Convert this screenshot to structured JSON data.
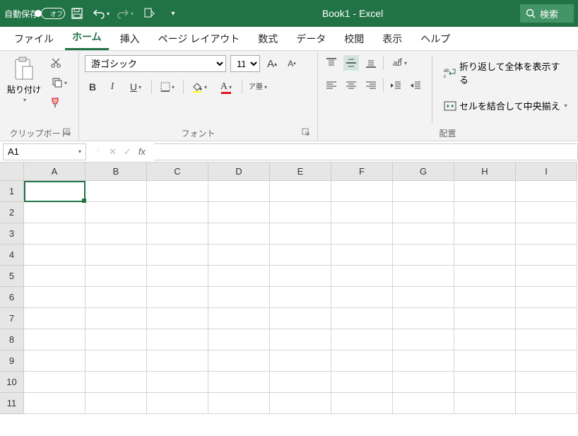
{
  "titlebar": {
    "autosave_label": "自動保存",
    "autosave_state": "オフ",
    "doc_title": "Book1  -  Excel",
    "search_placeholder": "検索"
  },
  "tabs": {
    "items": [
      "ファイル",
      "ホーム",
      "挿入",
      "ページ レイアウト",
      "数式",
      "データ",
      "校閲",
      "表示",
      "ヘルプ"
    ],
    "active_index": 1
  },
  "ribbon": {
    "clipboard": {
      "paste": "貼り付け",
      "label": "クリップボード"
    },
    "font": {
      "name": "游ゴシック",
      "size": "11",
      "label": "フォント",
      "bold": "B",
      "italic": "I",
      "underline": "U",
      "phonetic": "ア亜"
    },
    "align": {
      "label": "配置",
      "wrap": "折り返して全体を表示する",
      "merge": "セルを結合して中央揃え"
    }
  },
  "formula_bar": {
    "cell_ref": "A1",
    "fx": "fx",
    "value": ""
  },
  "sheet": {
    "columns": [
      "A",
      "B",
      "C",
      "D",
      "E",
      "F",
      "G",
      "H",
      "I"
    ],
    "rows": [
      "1",
      "2",
      "3",
      "4",
      "5",
      "6",
      "7",
      "8",
      "9",
      "10",
      "11"
    ],
    "selected": "A1"
  },
  "colors": {
    "brand": "#217346"
  }
}
